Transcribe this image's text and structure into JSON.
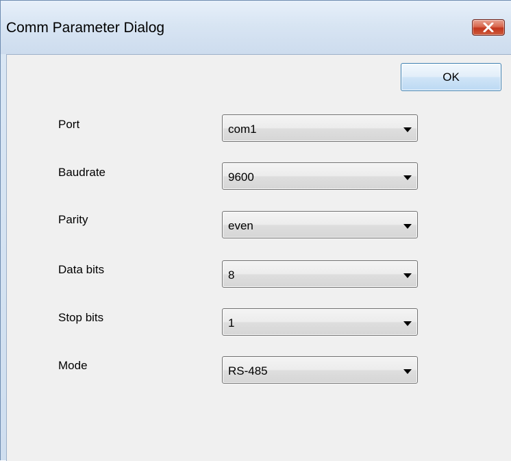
{
  "window": {
    "title": "Comm Parameter Dialog",
    "close_icon": "close-icon"
  },
  "buttons": {
    "ok_label": "OK"
  },
  "fields": [
    {
      "label": "Port",
      "value": "com1"
    },
    {
      "label": "Baudrate",
      "value": "9600"
    },
    {
      "label": "Parity",
      "value": "even"
    },
    {
      "label": "Data bits",
      "value": "8"
    },
    {
      "label": "Stop bits",
      "value": "1"
    },
    {
      "label": "Mode",
      "value": "RS-485"
    }
  ],
  "colors": {
    "close_button": "#c2361d",
    "ok_border": "#3c7fb1",
    "client_background": "#f0f0f0"
  }
}
